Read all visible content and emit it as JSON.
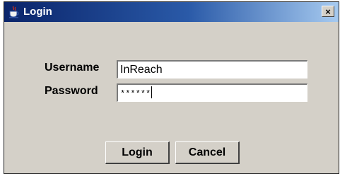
{
  "window": {
    "title": "Login",
    "close_glyph": "×",
    "icon": "java-coffee-cup-icon"
  },
  "form": {
    "username_label": "Username",
    "username_value": "InReach",
    "password_label": "Password",
    "password_masked": "******"
  },
  "buttons": {
    "login_label": "Login",
    "cancel_label": "Cancel"
  },
  "colors": {
    "titlebar_start": "#0a246a",
    "titlebar_end": "#a6caf0",
    "dialog_background": "#d4d0c8",
    "field_background": "#ffffff"
  }
}
